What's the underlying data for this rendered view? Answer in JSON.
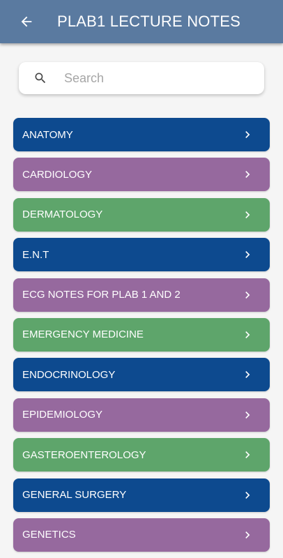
{
  "appbar": {
    "title": "PLAB1 LECTURE NOTES",
    "back_icon": "arrow-left-icon",
    "color": "#5a7aa0"
  },
  "search": {
    "placeholder": "Search",
    "value": "",
    "icon": "search-icon"
  },
  "palette": {
    "blue": "#0d4a8f",
    "purple": "#96699e",
    "green": "#5ea56b"
  },
  "topics": [
    {
      "label": "ANATOMY",
      "color": "#0d4a8f"
    },
    {
      "label": "CARDIOLOGY",
      "color": "#96699e"
    },
    {
      "label": "DERMATOLOGY",
      "color": "#5ea56b"
    },
    {
      "label": "E.N.T",
      "color": "#0d4a8f"
    },
    {
      "label": "ECG NOTES FOR PLAB 1 AND 2",
      "color": "#96699e"
    },
    {
      "label": "EMERGENCY MEDICINE",
      "color": "#5ea56b"
    },
    {
      "label": "ENDOCRINOLOGY",
      "color": "#0d4a8f"
    },
    {
      "label": "EPIDEMIOLOGY",
      "color": "#96699e"
    },
    {
      "label": "GASTEROENTEROLOGY",
      "color": "#5ea56b"
    },
    {
      "label": "GENERAL SURGERY",
      "color": "#0d4a8f"
    },
    {
      "label": "GENETICS",
      "color": "#96699e"
    }
  ]
}
